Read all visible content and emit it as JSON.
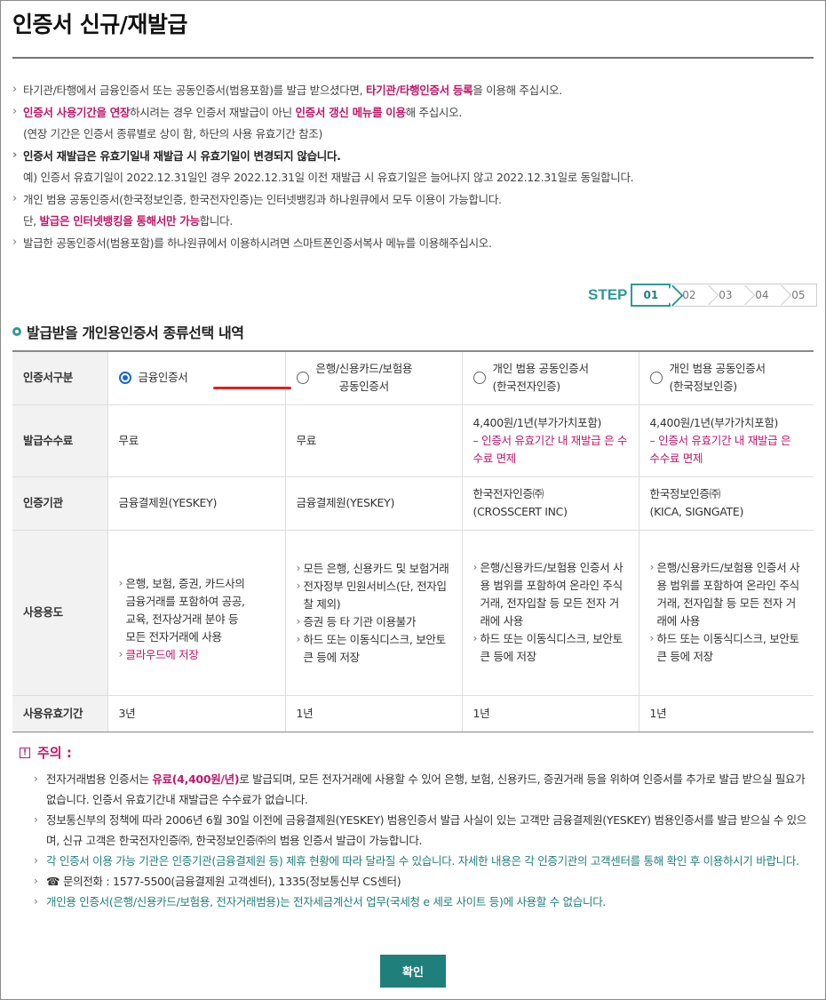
{
  "page": {
    "title": "인증서 신규/재발급"
  },
  "notices": {
    "n1_pre": "타기관/타행에서 금융인증서 또는 공동인증서(범용포함)를 발급 받으셨다면, ",
    "n1_link": "타기관/타행인증서 등록",
    "n1_post": "을 이용해 주십시오.",
    "n2_link1": "인증서 사용기간을 연장",
    "n2_mid": "하시려는 경우 인증서 재발급이 아닌 ",
    "n2_link2": "인증서 갱신 메뉴를 이용",
    "n2_post": "해 주십시오.",
    "n2_sub": "(연장 기간은 인증서 종류별로 상이 함, 하단의 사용 유효기간 참조)",
    "n3": "인증서 재발급은 유효기일내 재발급 시 유효기일이 변경되지 않습니다.",
    "n3_sub": "예) 인증서 유효기일이 2022.12.31일인 경우 2022.12.31일 이전 재발급 시 유효기일은 늘어나지 않고 2022.12.31일로 동일합니다.",
    "n4": "개인 범용 공동인증서(한국정보인증, 한국전자인증)는 인터넷뱅킹과 하나원큐에서 모두 이용이 가능합니다.",
    "n4_sub_pre": "단, ",
    "n4_sub_link": "발급은 인터넷뱅킹을 통해서만 가능",
    "n4_sub_post": "합니다.",
    "n5": "발급한 공동인증서(범용포함)를 하나원큐에서 이용하시려면 스마트폰인증서복사 메뉴를 이용해주십시오."
  },
  "steps": {
    "label": "STEP",
    "items": [
      "01",
      "02",
      "03",
      "04",
      "05"
    ],
    "active": "01"
  },
  "section_title": "발급받을 개인용인증서 종류선택 내역",
  "table": {
    "row_labels": {
      "type": "인증서구분",
      "fee": "발급수수료",
      "issuer": "인증기관",
      "usage": "사용용도",
      "validity": "사용유효기간"
    },
    "col1": {
      "type": "금융인증서",
      "fee": "무료",
      "issuer": "금융결제원(YESKEY)",
      "usage": [
        "은행, 보험, 증권, 카드사의",
        "금융거래를 포함하여 공공,",
        "교육, 전자상거래 분야 등",
        "모든 전자거래에 사용"
      ],
      "usage_note": "클라우드에 저장",
      "validity": "3년",
      "selected": true
    },
    "col2": {
      "type_line1": "은행/신용카드/보험용",
      "type_line2": "공동인증서",
      "fee": "무료",
      "issuer": "금융결제원(YESKEY)",
      "usage": [
        "모든 은행, 신용카드 및 보험거래",
        "전자정부 민원서비스(단, 전자입찰 제외)",
        "증권 등 타 기관 이용불가",
        "하드 또는 이동식디스크, 보안토큰 등에 저장"
      ],
      "validity": "1년"
    },
    "col3": {
      "type_line1": "개인 범용 공동인증서",
      "type_line2": "(한국전자인증)",
      "fee": "4,400원/1년(부가가치포함)",
      "fee_note": "– 인증서 유효기간 내 재발급 은 수수료 면제",
      "issuer_line1": "한국전자인증㈜",
      "issuer_line2": "(CROSSCERT INC)",
      "usage": [
        "은행/신용카드/보험용 인증서 사용 범위를 포함하여 온라인 주식거래, 전자입찰 등 모든 전자 거래에 사용",
        "하드 또는 이동식디스크, 보안토큰 등에 저장"
      ],
      "validity": "1년"
    },
    "col4": {
      "type_line1": "개인 범용 공동인증서",
      "type_line2": "(한국정보인증)",
      "fee": "4,400원/1년(부가가치포함)",
      "fee_note": "– 인증서 유효기간 내 재발급 은 수수료 면제",
      "issuer_line1": "한국정보인증㈜",
      "issuer_line2": "(KICA, SIGNGATE)",
      "usage": [
        "은행/신용카드/보험용 인증서 사용 범위를 포함하여 온라인 주식거래, 전자입찰 등 모든 전자 거래에 사용",
        "하드 또는 이동식디스크, 보안토큰 등에 저장"
      ],
      "validity": "1년"
    }
  },
  "caution": {
    "title": "주의 :",
    "c1_pre": "전자거래범용 인증서는 ",
    "c1_link": "유료(4,400원/년)",
    "c1_post": "로 발급되며, 모든 전자거래에 사용할 수 있어 은행, 보험, 신용카드, 증권거래 등을 위하여 인증서를 추가로 발급 받으실 필요가 없습니다. 인증서 유효기간내 재발급은 수수료가 없습니다.",
    "c2": "정보통신부의 정책에 따라 2006년 6월 30일 이전에 금융결제원(YESKEY) 범용인증서 발급 사실이 있는 고객만 금융결제원(YESKEY) 범용인증서를 발급 받으실 수 있으며, 신규 고객은 한국전자인증㈜, 한국정보인증㈜의 범용 인증서 발급이 가능합니다.",
    "c3": "각 인증서 이용 가능 기관은 인증기관(금융결제원 등) 제휴 현황에 따라 달라질 수 있습니다. 자세한 내용은 각 인증기관의 고객센터를 통해 확인 후 이용하시기 바랍니다.",
    "c4": "☎ 문의전화 : 1577-5500(금융결제원 고객센터), 1335(정보통신부 CS센터)",
    "c5": "개인용 인증서(은행/신용카드/보험용, 전자거래범용)는 전자세금계산서 업무(국세청 e 세로 사이트 등)에 사용할 수 없습니다."
  },
  "confirm_label": "확인",
  "colors": {
    "accent": "#1f7f7b",
    "highlight": "#c0186a",
    "radio_selected": "#1a66cc"
  }
}
